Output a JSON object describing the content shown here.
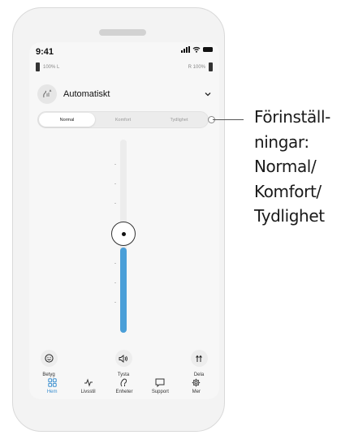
{
  "status_bar": {
    "time": "9:41"
  },
  "battery": {
    "left_label": "100% L",
    "right_label": "R 100%"
  },
  "program": {
    "title": "Automatiskt",
    "icon": "auto-program-icon"
  },
  "presets": {
    "options": [
      "Normal",
      "Komfort",
      "Tydlighet"
    ],
    "selected": "Normal"
  },
  "volume_slider": {
    "level_fraction": 0.44,
    "accent_color": "#4a9fd8"
  },
  "actions": [
    {
      "label": "Betyg",
      "icon": "smiley-icon"
    },
    {
      "label": "Tysta",
      "icon": "speaker-icon"
    },
    {
      "label": "Dela",
      "icon": "split-icon"
    }
  ],
  "nav": {
    "items": [
      {
        "label": "Hem",
        "icon": "home-grid-icon"
      },
      {
        "label": "Livsstil",
        "icon": "activity-icon"
      },
      {
        "label": "Enheter",
        "icon": "hearing-aid-icon"
      },
      {
        "label": "Support",
        "icon": "chat-icon"
      },
      {
        "label": "Mer",
        "icon": "gear-icon"
      }
    ],
    "active": "Hem",
    "active_color": "#3a8fd0"
  },
  "callout": {
    "lines": [
      "Förinställ-",
      "ningar:",
      "Normal/",
      "Komfort/",
      "Tydlighet"
    ]
  }
}
